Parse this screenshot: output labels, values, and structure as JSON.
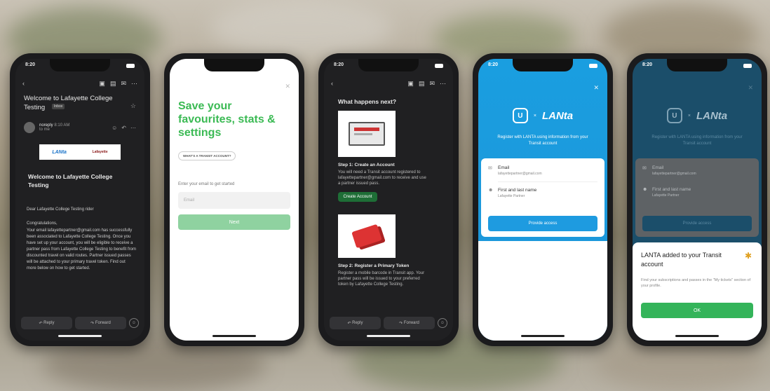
{
  "phone1": {
    "time": "8:20",
    "subject": "Welcome to Lafayette College Testing",
    "inbox_tag": "Inbox",
    "sender": "noreply",
    "sender_time": "8:10 AM",
    "to_me": "to me",
    "logo_left": "LANta",
    "logo_right": "Lafayette",
    "heading": "Welcome to Lafayette College Testing",
    "greeting": "Dear Lafayette College Testing rider",
    "congrats": "Congratulations,",
    "body": "Your email lafayettepartner@gmail.com has successfully been associated to Lafayette College Testing. Once you have set up your account, you will be eligible to receive a partner pass from Lafayette College Testing to benefit from discounted travel on valid routes. Partner issued passes will be attached to your primary travel token. Find out more below on how to get started.",
    "reply": "Reply",
    "forward": "Forward"
  },
  "phone2": {
    "title": "Save your favourites, stats & settings",
    "whats_button": "WHAT'S A TRANSIT ACCOUNT?",
    "prompt": "Enter your email to get started",
    "email_placeholder": "Email",
    "next": "Next"
  },
  "phone3": {
    "time": "8:20",
    "heading": "What happens next?",
    "step1_title": "Step 1: Create an Account",
    "step1_body": "You will need a Transit account registered to lafayettepartner@gmail.com to receive and use a partner issued pass.",
    "create_account": "Create Account",
    "step2_title": "Step 2: Register a Primary Token",
    "step2_body": "Register a mobile barcode in Transit app. Your partner pass will be issued to your preferred token by Lafayette College Testing.",
    "reply": "Reply",
    "forward": "Forward"
  },
  "phone4": {
    "time": "8:20",
    "brand": "LANta",
    "intro": "Register with LANTA using information from your Transit account",
    "email_label": "Email",
    "email_value": "lafayettepartner@gmail.com",
    "name_label": "First and last name",
    "name_value": "Lafayette Partner",
    "provide_access": "Provide access"
  },
  "phone5": {
    "time": "8:20",
    "brand": "LANta",
    "intro": "Register with LANTA using information from your Transit account",
    "email_label": "Email",
    "email_value": "lafayettepartner@gmail.com",
    "name_label": "First and last name",
    "name_value": "Lafayette Partner",
    "provide_access": "Provide access",
    "sheet_title": "LANTA added to your Transit account",
    "sheet_body": "Find your subscriptions and passes in the \"My tickets\" section of your profile.",
    "ok": "OK"
  },
  "colors": {
    "green": "#3bba54",
    "blue": "#1e9be0",
    "dark": "#202022"
  }
}
